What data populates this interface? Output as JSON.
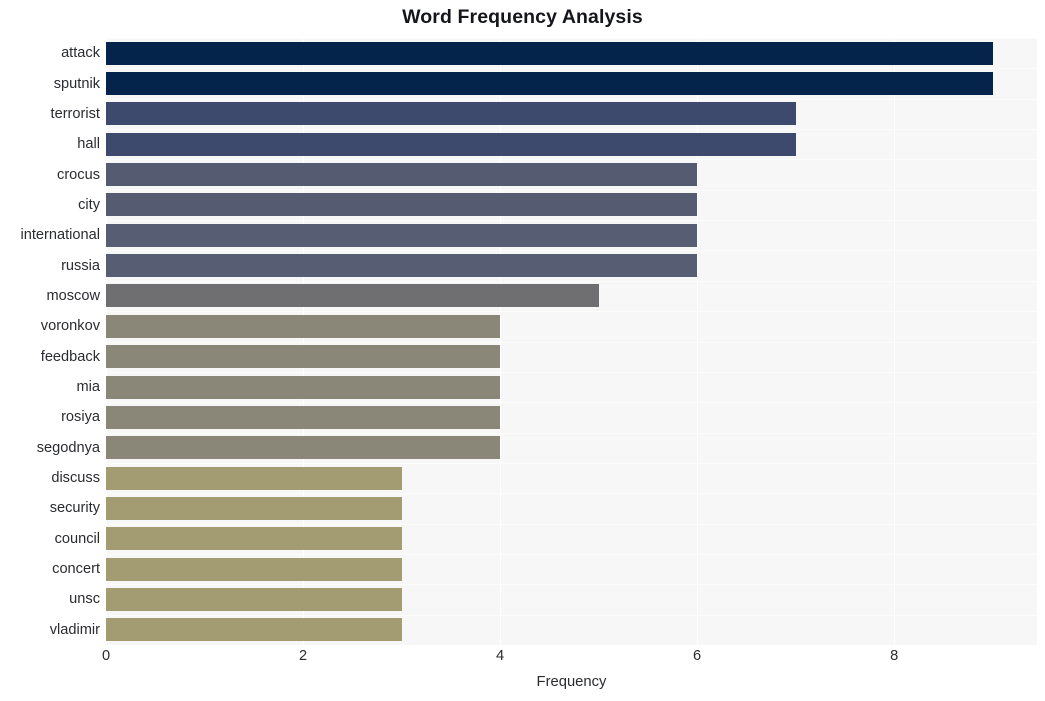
{
  "chart_data": {
    "type": "bar",
    "orientation": "horizontal",
    "title": "Word Frequency Analysis",
    "xlabel": "Frequency",
    "ylabel": "",
    "categories": [
      "attack",
      "sputnik",
      "terrorist",
      "hall",
      "crocus",
      "city",
      "international",
      "russia",
      "moscow",
      "voronkov",
      "feedback",
      "mia",
      "rosiya",
      "segodnya",
      "discuss",
      "security",
      "council",
      "concert",
      "unsc",
      "vladimir"
    ],
    "values": [
      9,
      9,
      7,
      7,
      6,
      6,
      6,
      6,
      5,
      4,
      4,
      4,
      4,
      4,
      3,
      3,
      3,
      3,
      3,
      3
    ],
    "bar_colors": [
      "#04244c",
      "#04244c",
      "#3d4a6d",
      "#3d4a6d",
      "#555b70",
      "#555b70",
      "#575d73",
      "#575d73",
      "#6f6f71",
      "#8a8779",
      "#8a8779",
      "#8a8779",
      "#8a8779",
      "#8a8779",
      "#a39b72",
      "#a39b72",
      "#a39b72",
      "#a39b72",
      "#a39b72",
      "#a39b72"
    ],
    "xlim": [
      0,
      9.45
    ],
    "xticks": [
      0,
      2,
      4,
      6,
      8
    ],
    "xtick_labels": [
      "0",
      "2",
      "4",
      "6",
      "8"
    ],
    "grid": true,
    "grid_axis": "x",
    "legend": null,
    "style": {
      "plot_background": "#f7f7f7",
      "figure_background": "#ffffff",
      "gridline_color": "#ffffff",
      "text_color": "#2a2c30",
      "title_color": "#14161a"
    }
  }
}
